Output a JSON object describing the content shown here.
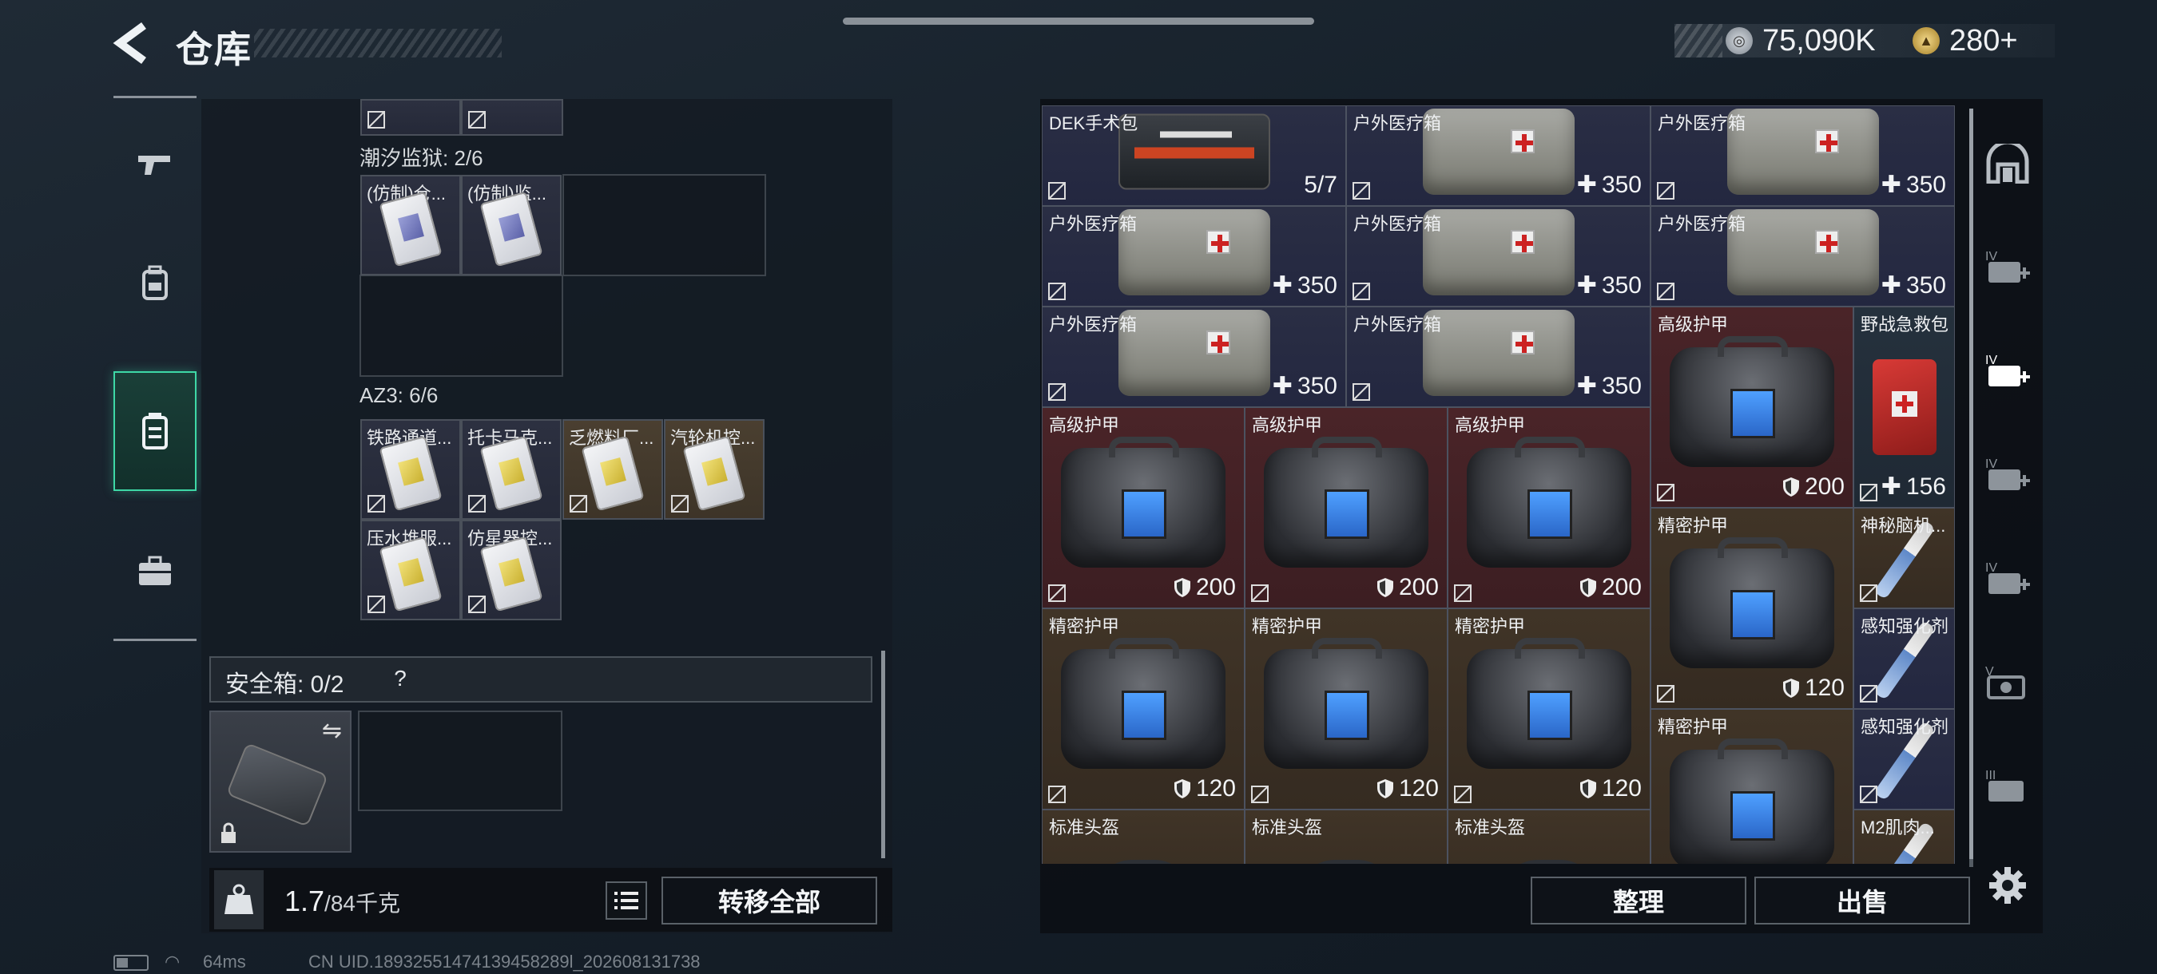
{
  "header": {
    "title": "仓库",
    "currency_a": "75,090K",
    "currency_b": "280+"
  },
  "left": {
    "group1_label": "潮汐监狱: 2/6",
    "group1_items": [
      "(仿制)仓...",
      "(仿制)监..."
    ],
    "group2_label": "AZ3: 6/6",
    "group2_items": [
      "铁路通道...",
      "托卡马克...",
      "乏燃料厂...",
      "汽轮机控...",
      "压水堆服...",
      "仿星器控..."
    ],
    "safebox_label": "安全箱: 0/2",
    "safebox_help": "?",
    "weight_value": "1.7",
    "weight_total": "/84千克",
    "weight_icon_text": "KG",
    "transfer_all": "转移全部"
  },
  "right": {
    "items": [
      {
        "name": "DEK手术包",
        "value": "5/7",
        "color": "blue",
        "art": "pouch",
        "icon": ""
      },
      {
        "name": "户外医疗箱",
        "value": "350",
        "color": "blue",
        "art": "medkit",
        "icon": "plus"
      },
      {
        "name": "户外医疗箱",
        "value": "350",
        "color": "blue",
        "art": "medkit",
        "icon": "plus"
      },
      {
        "name": "户外医疗箱",
        "value": "350",
        "color": "blue",
        "art": "medkit",
        "icon": "plus"
      },
      {
        "name": "户外医疗箱",
        "value": "350",
        "color": "blue",
        "art": "medkit",
        "icon": "plus"
      },
      {
        "name": "户外医疗箱",
        "value": "350",
        "color": "blue",
        "art": "medkit",
        "icon": "plus"
      },
      {
        "name": "户外医疗箱",
        "value": "350",
        "color": "blue",
        "art": "medkit",
        "icon": "plus"
      },
      {
        "name": "户外医疗箱",
        "value": "350",
        "color": "blue",
        "art": "medkit",
        "icon": "plus"
      },
      {
        "name": "高级护甲",
        "value": "200",
        "color": "red",
        "art": "bag",
        "icon": "shield"
      },
      {
        "name": "野战急救包",
        "value": "156",
        "color": "slate",
        "art": "redcase",
        "icon": "plus"
      },
      {
        "name": "高级护甲",
        "value": "200",
        "color": "red",
        "art": "bag",
        "icon": "shield"
      },
      {
        "name": "高级护甲",
        "value": "200",
        "color": "red",
        "art": "bag",
        "icon": "shield"
      },
      {
        "name": "高级护甲",
        "value": "200",
        "color": "red",
        "art": "bag",
        "icon": "shield"
      },
      {
        "name": "精密护甲",
        "value": "120",
        "color": "tan",
        "art": "bag",
        "icon": "shield"
      },
      {
        "name": "神秘脑机...",
        "value": "",
        "color": "tan",
        "art": "syringe",
        "icon": ""
      },
      {
        "name": "精密护甲",
        "value": "120",
        "color": "tan",
        "art": "bag",
        "icon": "shield"
      },
      {
        "name": "精密护甲",
        "value": "120",
        "color": "tan",
        "art": "bag",
        "icon": "shield"
      },
      {
        "name": "精密护甲",
        "value": "120",
        "color": "tan",
        "art": "bag",
        "icon": "shield"
      },
      {
        "name": "感知强化剂",
        "value": "",
        "color": "blue",
        "art": "syringe",
        "icon": ""
      },
      {
        "name": "精密护甲",
        "value": "",
        "color": "tan",
        "art": "bag",
        "icon": ""
      },
      {
        "name": "感知强化剂",
        "value": "",
        "color": "blue",
        "art": "syringe",
        "icon": ""
      },
      {
        "name": "标准头盔",
        "value": "",
        "color": "tan",
        "art": "helmet",
        "icon": ""
      },
      {
        "name": "标准头盔",
        "value": "",
        "color": "tan",
        "art": "helmet",
        "icon": ""
      },
      {
        "name": "标准头盔",
        "value": "",
        "color": "tan",
        "art": "helmet",
        "icon": ""
      },
      {
        "name": "M2肌肉...",
        "value": "",
        "color": "tan",
        "art": "syringe",
        "icon": ""
      }
    ],
    "sort_label": "整理",
    "sell_label": "出售"
  },
  "sidebar": {
    "items": [
      "gun-icon",
      "backpack-icon",
      "storage-icon",
      "case-icon"
    ],
    "active_index": 2
  },
  "right_nav": {
    "labels": [
      "",
      "IV",
      "IV",
      "IV",
      "IV",
      "V",
      "III"
    ]
  },
  "status": {
    "ping": "64ms",
    "uid": "CN UID.18932551474139458289l_202608131738"
  },
  "colors": {
    "accent": "#3ed8a6",
    "rarity_red": "#4a2428",
    "rarity_tan": "#403427",
    "rarity_blue": "#2a2e44"
  }
}
